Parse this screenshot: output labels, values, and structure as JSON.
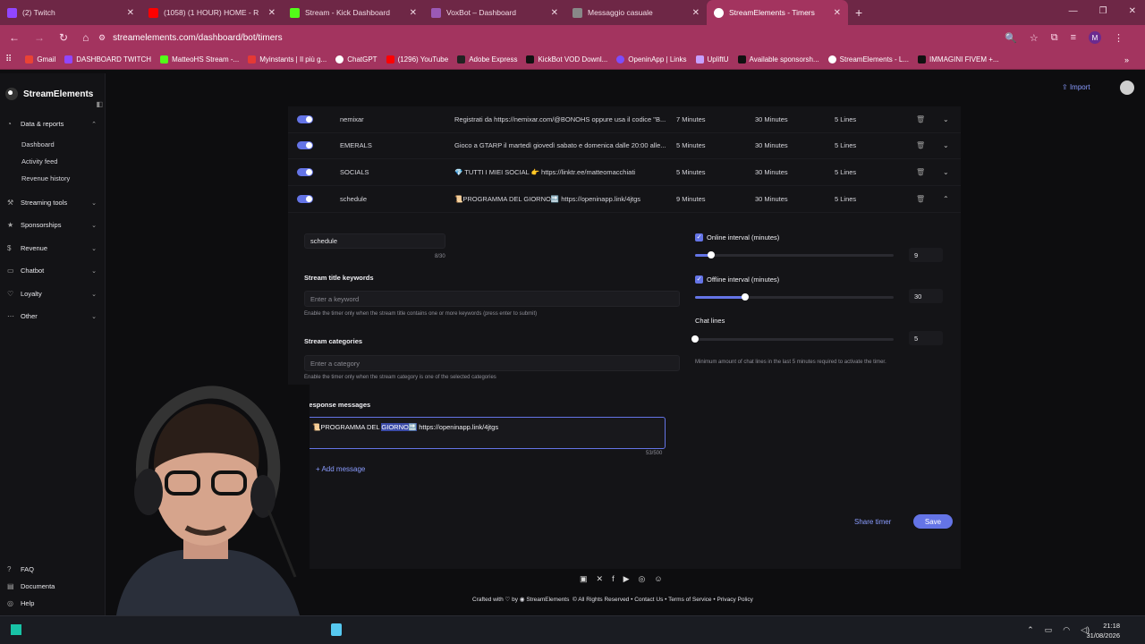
{
  "browser": {
    "tabs": [
      {
        "title": "(2) Twitch",
        "color": "#9146ff"
      },
      {
        "title": "(1058) (1 HOUR) HOME - R",
        "color": "#ff0000"
      },
      {
        "title": "Stream - Kick Dashboard",
        "color": "#53fc18"
      },
      {
        "title": "VoxBot – Dashboard",
        "color": "#9b59b6"
      },
      {
        "title": "Messaggio casuale",
        "color": "#888888"
      },
      {
        "title": "StreamElements - Timers",
        "color": "#ffffff"
      }
    ],
    "url": "streamelements.com/dashboard/bot/timers",
    "profile_initial": "M",
    "bookmarks": [
      "Gmail",
      "DASHBOARD TWITCH",
      "MatteoHS Stream -...",
      "Myinstants | Il più g...",
      "ChatGPT",
      "(1296) YouTube",
      "Adobe Express",
      "KickBot VOD Downl...",
      "OpeninApp | Links",
      "UpliftU",
      "Available sponsorsh...",
      "StreamElements - L...",
      "IMMAGINI FIVEM +..."
    ]
  },
  "sidebar": {
    "brand": "StreamElements",
    "data_reports": "Data & reports",
    "dashboard": "Dashboard",
    "activity_feed": "Activity feed",
    "revenue_history": "Revenue history",
    "streaming_tools": "Streaming tools",
    "sponsorships": "Sponsorships",
    "revenue": "Revenue",
    "chatbot": "Chatbot",
    "loyalty": "Loyalty",
    "other": "Other",
    "faq": "FAQ",
    "documentation": "Documenta",
    "help": "Help"
  },
  "header": {
    "import": "Import"
  },
  "timers": [
    {
      "name": "nemixar",
      "message": "Registrati da https://nemixar.com/@BONOHS oppure usa il codice \"B...",
      "online": "7 Minutes",
      "offline": "30 Minutes",
      "lines": "5 Lines"
    },
    {
      "name": "EMERALS",
      "message": "Gioco a GTARP il martedì giovedì sabato e domenica dalle 20:00 alle...",
      "online": "5 Minutes",
      "offline": "30 Minutes",
      "lines": "5 Lines"
    },
    {
      "name": "SOCIALS",
      "message": "💎 TUTTI I MIEI SOCIAL 👉 https://linktr.ee/matteomacchiati",
      "online": "5 Minutes",
      "offline": "30 Minutes",
      "lines": "5 Lines"
    },
    {
      "name": "schedule",
      "message": "📜PROGRAMMA DEL GIORNO🔜 https://openinapp.link/4jtgs",
      "online": "9 Minutes",
      "offline": "30 Minutes",
      "lines": "5 Lines"
    }
  ],
  "editor": {
    "name_value": "schedule",
    "name_count": "8/30",
    "keywords_label": "Stream title keywords",
    "keywords_placeholder": "Enter a keyword",
    "keywords_help": "Enable the timer only when the stream title contains one or more keywords (press enter to submit)",
    "categories_label": "Stream categories",
    "categories_placeholder": "Enter a category",
    "categories_help": "Enable the timer only when the stream category is one of the selected categories",
    "response_label": "Response messages",
    "msg_before": "📜PROGRAMMA DEL ",
    "msg_selected": "GIORNO🔜",
    "msg_after": " https://openinapp.link/4jtgs",
    "msg_count": "53/500",
    "add_message": "+ Add message",
    "online_label": "Online interval (minutes)",
    "online_value": "9",
    "online_fraction": 0.08,
    "offline_label": "Offline interval (minutes)",
    "offline_value": "30",
    "offline_fraction": 0.25,
    "chat_lines_label": "Chat lines",
    "chat_lines_value": "5",
    "chat_lines_fraction": 0.0,
    "chat_lines_help": "Minimum amount of chat lines in the last 5 minutes required to activate the timer.",
    "share": "Share timer",
    "save": "Save"
  },
  "footer": {
    "crafted": "Crafted with",
    "by": "by",
    "brand": "StreamElements",
    "rights": "© All Rights Reserved",
    "contact": "• Contact Us",
    "terms": "• Terms of Service",
    "privacy": "• Privacy Policy"
  },
  "taskbar": {
    "time": "21:18",
    "date": "31/08/2026"
  }
}
